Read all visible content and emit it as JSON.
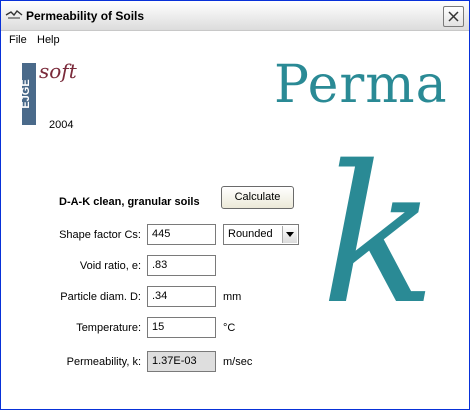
{
  "window": {
    "title": "Permeability of Soils"
  },
  "menu": {
    "file": "File",
    "help": "Help"
  },
  "logo": {
    "side_text": "EJGE",
    "soft_text": "soft",
    "year": "2004"
  },
  "brand": {
    "text": "Perma",
    "symbol": "k"
  },
  "form": {
    "section_title": "D-A-K clean, granular soils",
    "calculate_label": "Calculate",
    "shape_factor": {
      "label": "Shape factor Cs:",
      "value": "445",
      "option": "Rounded"
    },
    "void_ratio": {
      "label": "Void ratio, e:",
      "value": ".83"
    },
    "particle_diam": {
      "label": "Particle diam. D:",
      "value": ".34",
      "unit": "mm"
    },
    "temperature": {
      "label": "Temperature:",
      "value": "15",
      "unit": "°C"
    },
    "permeability": {
      "label": "Permeability, k:",
      "value": "1.37E-03",
      "unit": "m/sec"
    }
  },
  "colors": {
    "brand": "#2a8a95",
    "soft_logo": "#7a2a3a"
  }
}
